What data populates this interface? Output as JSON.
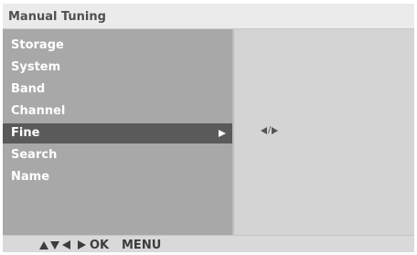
{
  "title": "Manual Tuning",
  "menu": {
    "items": [
      {
        "label": "Storage",
        "selected": false
      },
      {
        "label": "System",
        "selected": false
      },
      {
        "label": "Band",
        "selected": false
      },
      {
        "label": "Channel",
        "selected": false
      },
      {
        "label": "Fine",
        "selected": true,
        "icon": "arrow-right-icon"
      },
      {
        "label": "Search",
        "selected": false
      },
      {
        "label": "Name",
        "selected": false
      }
    ]
  },
  "value_panel": {
    "indicator_separator": "/",
    "indicator_icons": [
      "arrow-left-icon",
      "arrow-right-icon"
    ]
  },
  "footer": {
    "nav_icons": [
      "arrow-up-icon",
      "arrow-down-icon",
      "arrow-left-icon",
      "arrow-right-icon"
    ],
    "ok_label": "OK",
    "menu_label": "MENU"
  },
  "colors": {
    "title_bg": "#ebebeb",
    "title_text": "#505050",
    "menu_bg": "#a8a8a8",
    "selected_bg": "#5a5a5a",
    "menu_text": "#ffffff",
    "value_bg": "#d4d4d4",
    "footer_bg": "#d9d9d9",
    "footer_text": "#3c3c3c"
  }
}
